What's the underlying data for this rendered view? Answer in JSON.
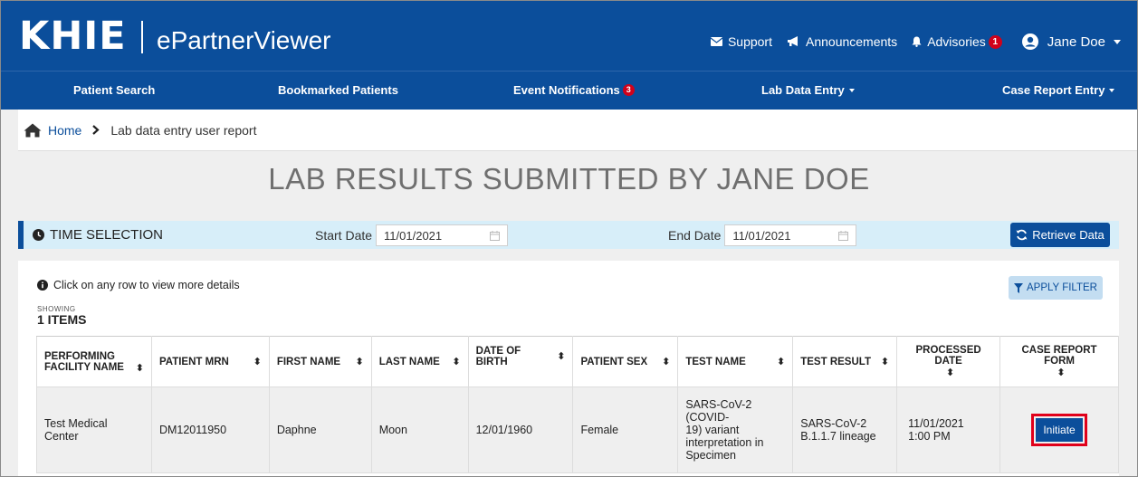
{
  "header": {
    "logo": "KHIE",
    "app_title": "ePartnerViewer",
    "support": "Support",
    "announcements": "Announcements",
    "advisories": "Advisories",
    "advisories_count": "1",
    "user_name": "Jane Doe"
  },
  "nav": {
    "patient_search": "Patient Search",
    "bookmarked": "Bookmarked Patients",
    "event_notifications": "Event Notifications",
    "event_count": "3",
    "lab_entry": "Lab Data Entry",
    "case_report": "Case Report Entry"
  },
  "breadcrumb": {
    "home": "Home",
    "current": "Lab data entry user report"
  },
  "page_title": "LAB RESULTS SUBMITTED BY JANE DOE",
  "time_selection": {
    "label": "TIME SELECTION",
    "start_label": "Start Date",
    "start_value": "11/01/2021",
    "end_label": "End Date",
    "end_value": "11/01/2021",
    "retrieve": "Retrieve Data"
  },
  "panel": {
    "hint": "Click on any row to view more details",
    "apply_filter": "APPLY FILTER",
    "showing": "SHOWING",
    "items": "1 ITEMS"
  },
  "table": {
    "headers": {
      "facility_1": "PERFORMING",
      "facility_2": "FACILITY NAME",
      "mrn": "PATIENT MRN",
      "first": "FIRST NAME",
      "last": "LAST NAME",
      "dob": "DATE OF BIRTH",
      "sex": "PATIENT SEX",
      "test": "TEST NAME",
      "result": "TEST RESULT",
      "processed": "PROCESSED DATE",
      "case_form": "CASE REPORT FORM"
    },
    "row": {
      "facility": "Test Medical Center",
      "mrn": "DM12011950",
      "first": "Daphne",
      "last": "Moon",
      "dob": "12/01/1960",
      "sex": "Female",
      "test_1": "SARS-CoV-2 (COVID-",
      "test_2": "19) variant",
      "test_3": "interpretation in",
      "test_4": "Specimen",
      "result_1": "SARS-CoV-2",
      "result_2": "B.1.1.7 lineage",
      "processed_1": "11/01/2021",
      "processed_2": "1:00 PM",
      "action": "Initiate"
    }
  },
  "colors": {
    "brand_blue": "#0b4e9b",
    "badge_red": "#d0021b",
    "highlight_red": "#e0001a",
    "time_bar_bg": "#d7eef9"
  }
}
